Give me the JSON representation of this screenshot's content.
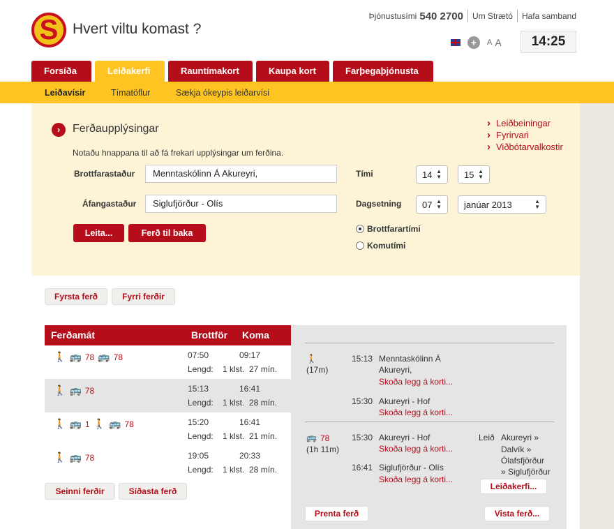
{
  "brand": {
    "logo_letter": "S",
    "tagline": "Hvert viltu komast ?"
  },
  "top": {
    "phone_label": "Þjónustusími",
    "phone": "540 2700",
    "link1": "Um Strætó",
    "link2": "Hafa samband",
    "font_small": "A",
    "font_large": "A",
    "clock": "14:25"
  },
  "tabs": [
    "Forsíða",
    "Leiðakerfi",
    "Rauntímakort",
    "Kaupa kort",
    "Farþegaþjónusta"
  ],
  "subnav": [
    "Leiðavísir",
    "Tímatöflur",
    "Sækja ókeypis leiðarvísi"
  ],
  "form": {
    "title": "Ferðaupplýsingar",
    "note": "Notaðu hnappana til að fá frekari upplýsingar um ferðina.",
    "links": [
      "Leiðbeiningar",
      "Fyrirvari",
      "Viðbótarvalkostir"
    ],
    "from_label": "Brottfarastaður",
    "from_value": "Menntaskólinn Á Akureyri,",
    "to_label": "Áfangastaður",
    "to_value": "Siglufjörður - Olís",
    "time_label": "Tími",
    "hour": "14",
    "minute": "15",
    "date_label": "Dagsetning",
    "day": "07",
    "month": "janúar 2013",
    "search_btn": "Leita...",
    "return_btn": "Ferð til baka",
    "radio_departure": "Brottfarartími",
    "radio_arrival": "Komutími"
  },
  "nav": {
    "first": "Fyrsta ferð",
    "earlier": "Fyrri ferðir",
    "later": "Seinni ferðir",
    "last": "Síðasta ferð"
  },
  "results": {
    "h_trip": "Ferðamát",
    "h_dep": "Brottför",
    "h_arr": "Koma",
    "length_label": "Lengd:",
    "rows": [
      {
        "routes": [
          "78",
          "78"
        ],
        "dep": "07:50",
        "arr": "09:17",
        "len": "1 klst.  27 mín."
      },
      {
        "routes": [
          "78"
        ],
        "dep": "15:13",
        "arr": "16:41",
        "len": "1 klst.  28 mín."
      },
      {
        "routes": [
          "1",
          "78"
        ],
        "dep": "15:20",
        "arr": "16:41",
        "len": "1 klst.  21 mín."
      },
      {
        "routes": [
          "78"
        ],
        "dep": "19:05",
        "arr": "20:33",
        "len": "1 klst.  28 mín."
      }
    ]
  },
  "detail": {
    "walk_dur": "(17m)",
    "w1_time": "15:13",
    "w1_stop1": "Menntaskólinn Á",
    "w1_stop2": "Akureyri,",
    "w1_link": "Skoða legg á korti...",
    "w2_time": "15:30",
    "w2_stop": "Akureyri - Hof",
    "w2_link": "Skoða legg á korti...",
    "bus_route": "78",
    "bus_dur": "(1h 11m)",
    "b1_time": "15:30",
    "b1_stop": "Akureyri - Hof",
    "b1_link": "Skoða legg á korti...",
    "b2_time": "16:41",
    "b2_stop": "Siglufjörður - Olís",
    "b2_link": "Skoða legg á korti...",
    "leid_label": "Leið",
    "leid_lines": [
      "Akureyri »",
      "Dalvík »",
      "Ólafsfjörður",
      "» Siglufjörður"
    ],
    "leidakerfi_btn": "Leiðakerfi...",
    "print_btn": "Prenta ferð",
    "save_btn": "Vista ferð..."
  }
}
